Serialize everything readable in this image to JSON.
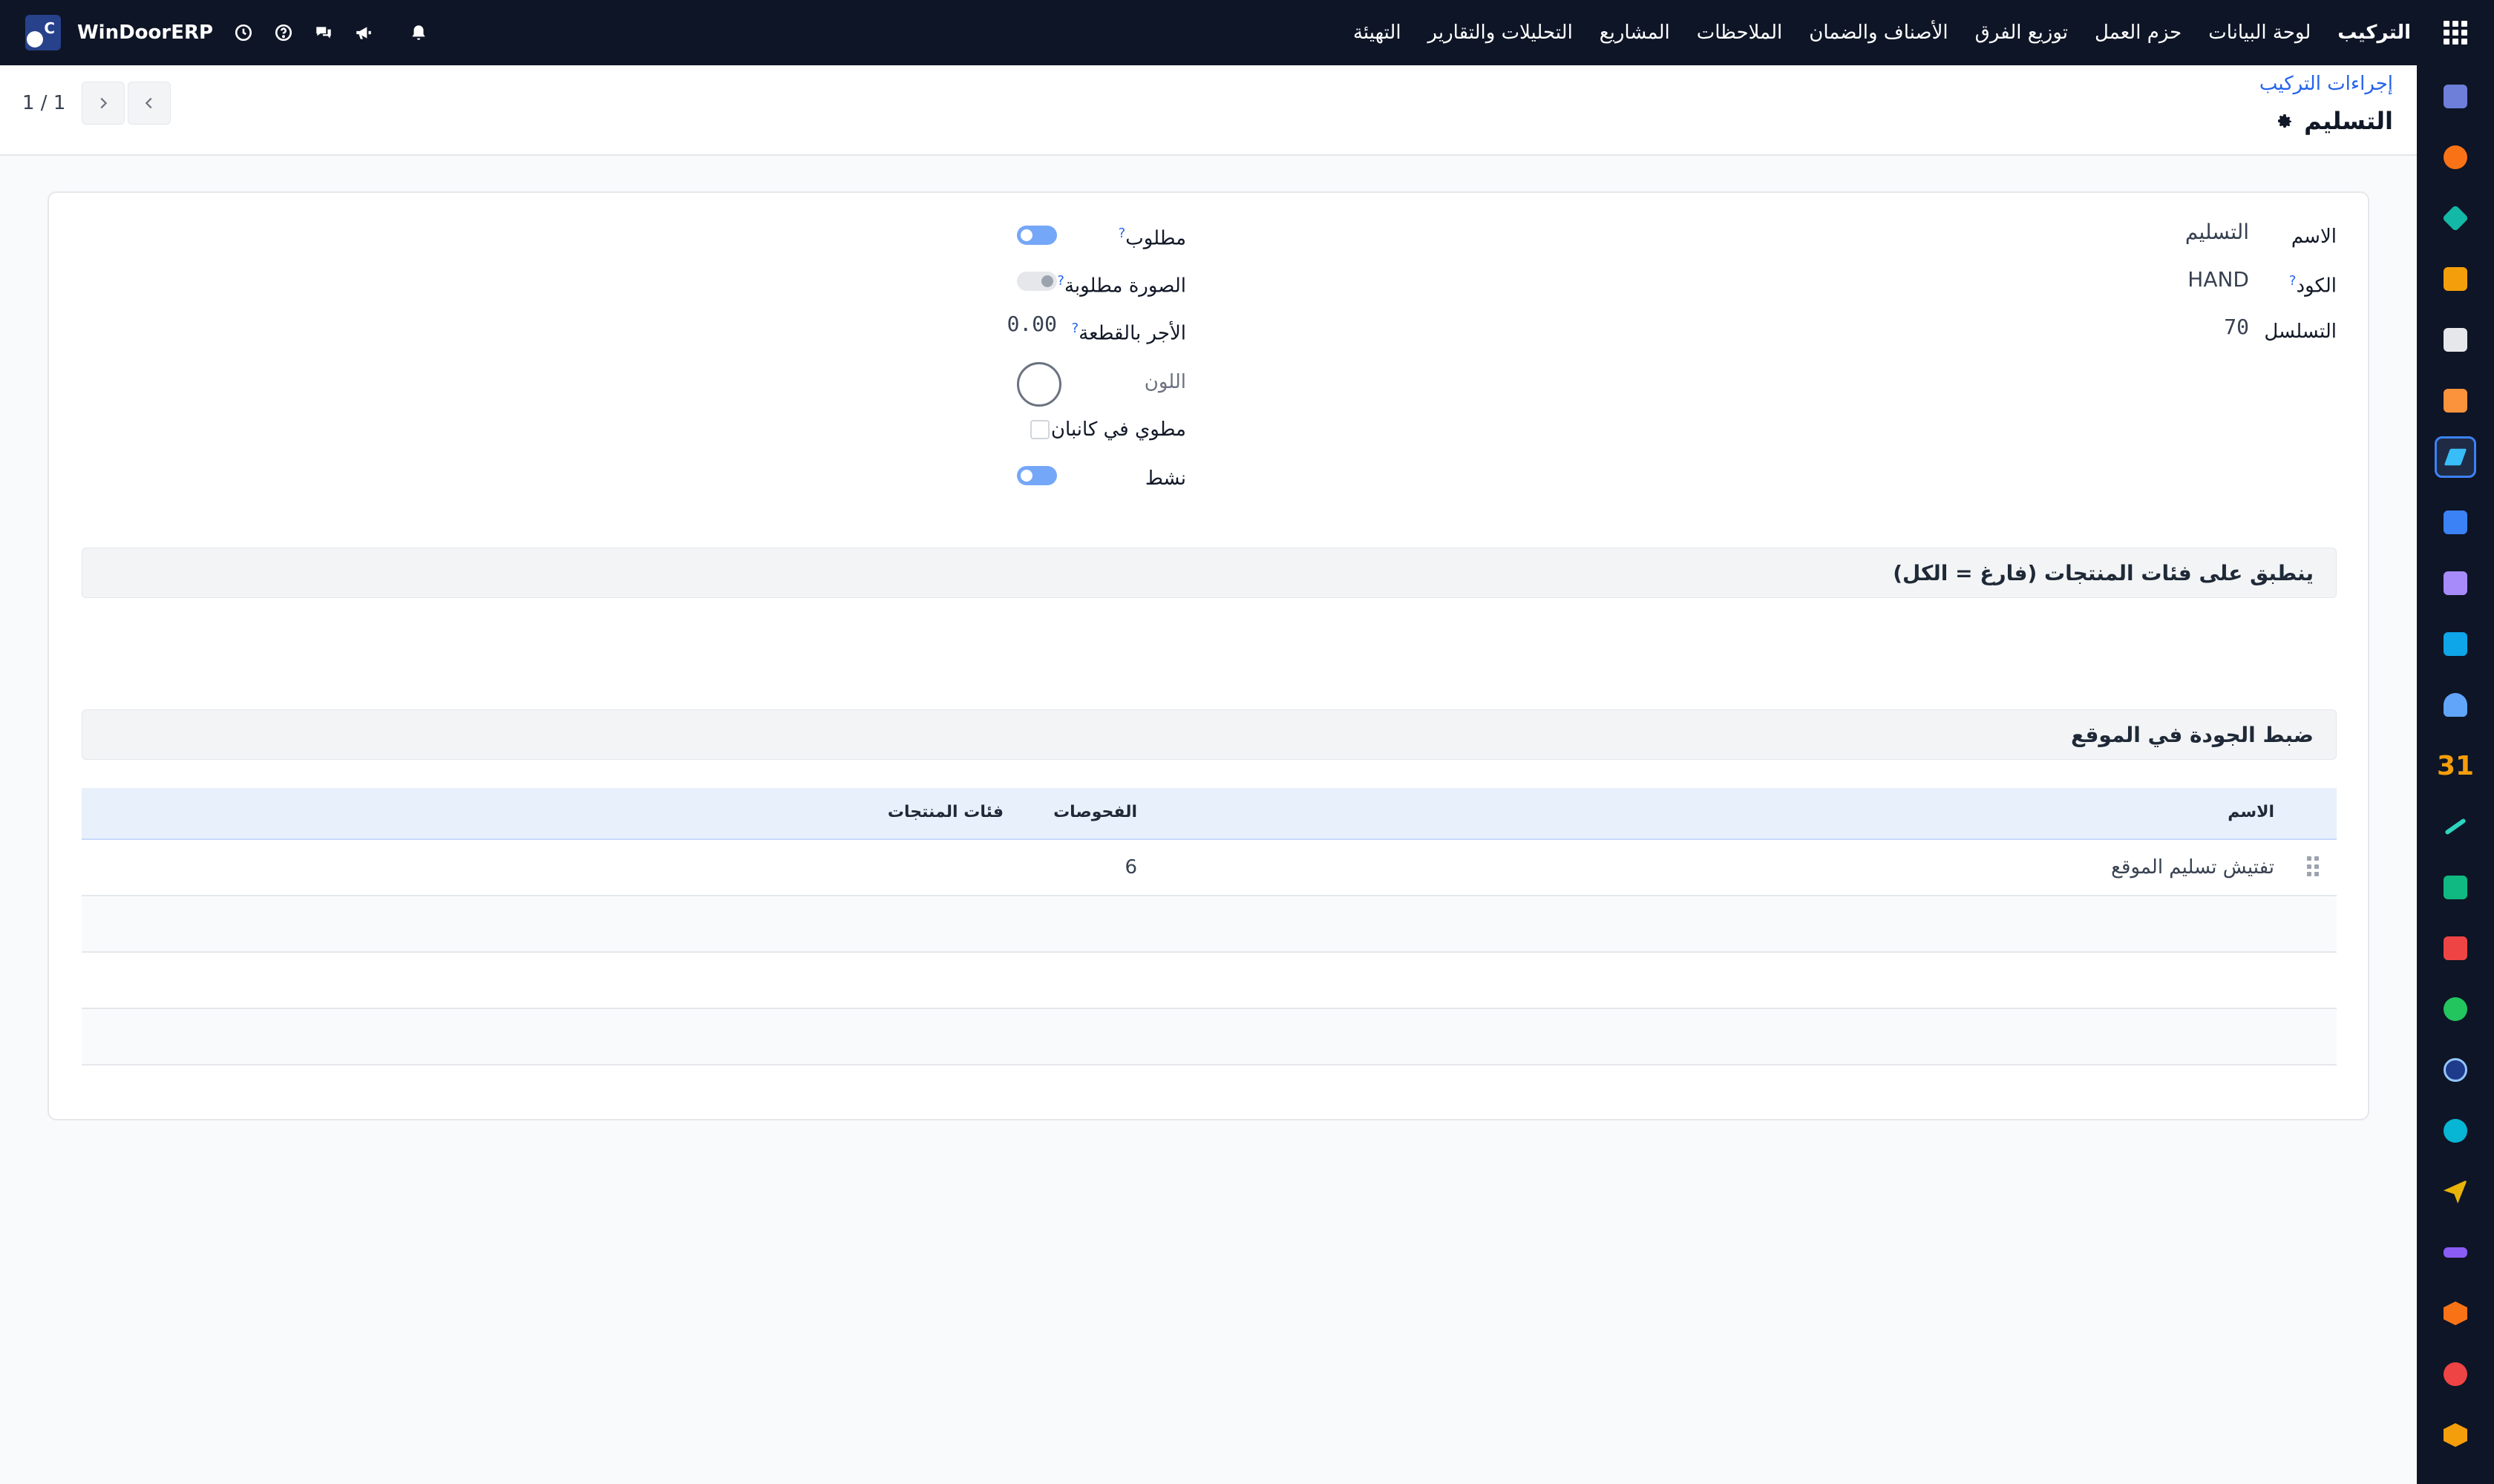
{
  "navbar": {
    "brand": "التركيب",
    "menu": [
      "لوحة البيانات",
      "حزم العمل",
      "توزيع الفرق",
      "الأصناف والضمان",
      "الملاحظات",
      "المشاريع",
      "التحليلات والتقارير",
      "التهيئة"
    ],
    "company": "WinDoorERP",
    "icons": [
      "clock-icon",
      "help-icon",
      "chat-icon",
      "megaphone-icon",
      "bell-icon"
    ]
  },
  "control_panel": {
    "breadcrumb": "إجراءات التركيب",
    "title": "التسليم",
    "pager": "1 / 1"
  },
  "form": {
    "name": {
      "label": "الاسم",
      "value": "التسليم"
    },
    "code": {
      "label": "الكود",
      "help": "?",
      "value": "HAND"
    },
    "sequence": {
      "label": "التسلسل",
      "value": "70"
    },
    "required": {
      "label": "مطلوب",
      "help": "?",
      "on": true
    },
    "photo_required": {
      "label": "الصورة مطلوبة",
      "help": "?",
      "on": false
    },
    "piece_rate": {
      "label": "الأجر بالقطعة",
      "help": "?",
      "value": "0.00"
    },
    "color": {
      "label": "اللون"
    },
    "folded_kanban": {
      "label": "مطوي في كانبان",
      "checked": false
    },
    "active": {
      "label": "نشط",
      "on": true
    }
  },
  "sections": {
    "categories": "ينطبق على فئات المنتجات (فارغ = الكل)",
    "quality": "ضبط الجودة في الموقع"
  },
  "qc_table": {
    "columns": {
      "name": "الاسم",
      "checks": "الفحوصات",
      "categories": "فئات المنتجات"
    },
    "rows": [
      {
        "name": "تفتيش تسليم الموقع",
        "checks": "6",
        "categories": ""
      }
    ]
  },
  "colors": {
    "navbar": "#0e1526",
    "accent": "#2563eb",
    "table_header": "#e8f0fc"
  }
}
